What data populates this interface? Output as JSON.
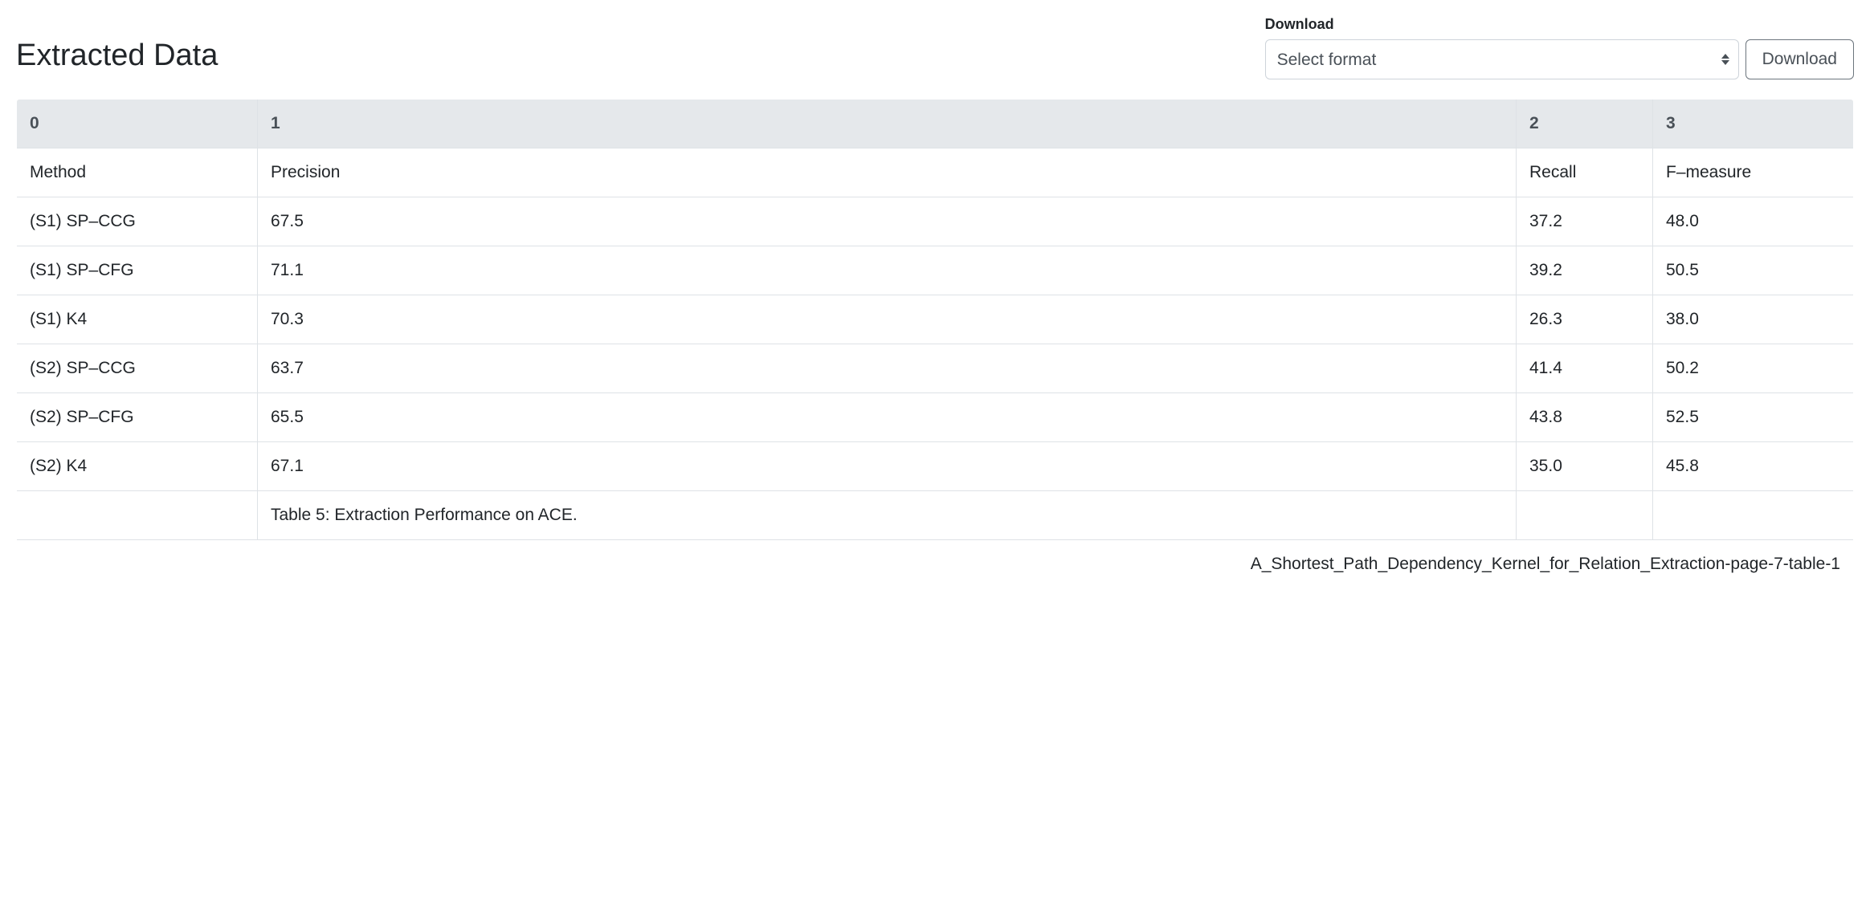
{
  "header": {
    "title": "Extracted Data"
  },
  "download": {
    "label": "Download",
    "select_placeholder": "Select format",
    "button_label": "Download"
  },
  "table": {
    "headers": [
      "0",
      "1",
      "2",
      "3"
    ],
    "rows": [
      [
        "Method",
        "Precision",
        "Recall",
        "F–measure"
      ],
      [
        "(S1) SP–CCG",
        "67.5",
        "37.2",
        "48.0"
      ],
      [
        "(S1) SP–CFG",
        "71.1",
        "39.2",
        "50.5"
      ],
      [
        "(S1) K4",
        "70.3",
        "26.3",
        "38.0"
      ],
      [
        "(S2) SP–CCG",
        "63.7",
        "41.4",
        "50.2"
      ],
      [
        "(S2) SP–CFG",
        "65.5",
        "43.8",
        "52.5"
      ],
      [
        "(S2) K4",
        "67.1",
        "35.0",
        "45.8"
      ],
      [
        "",
        "Table 5: Extraction Performance on ACE.",
        "",
        ""
      ]
    ],
    "caption": "A_Shortest_Path_Dependency_Kernel_for_Relation_Extraction-page-7-table-1"
  }
}
